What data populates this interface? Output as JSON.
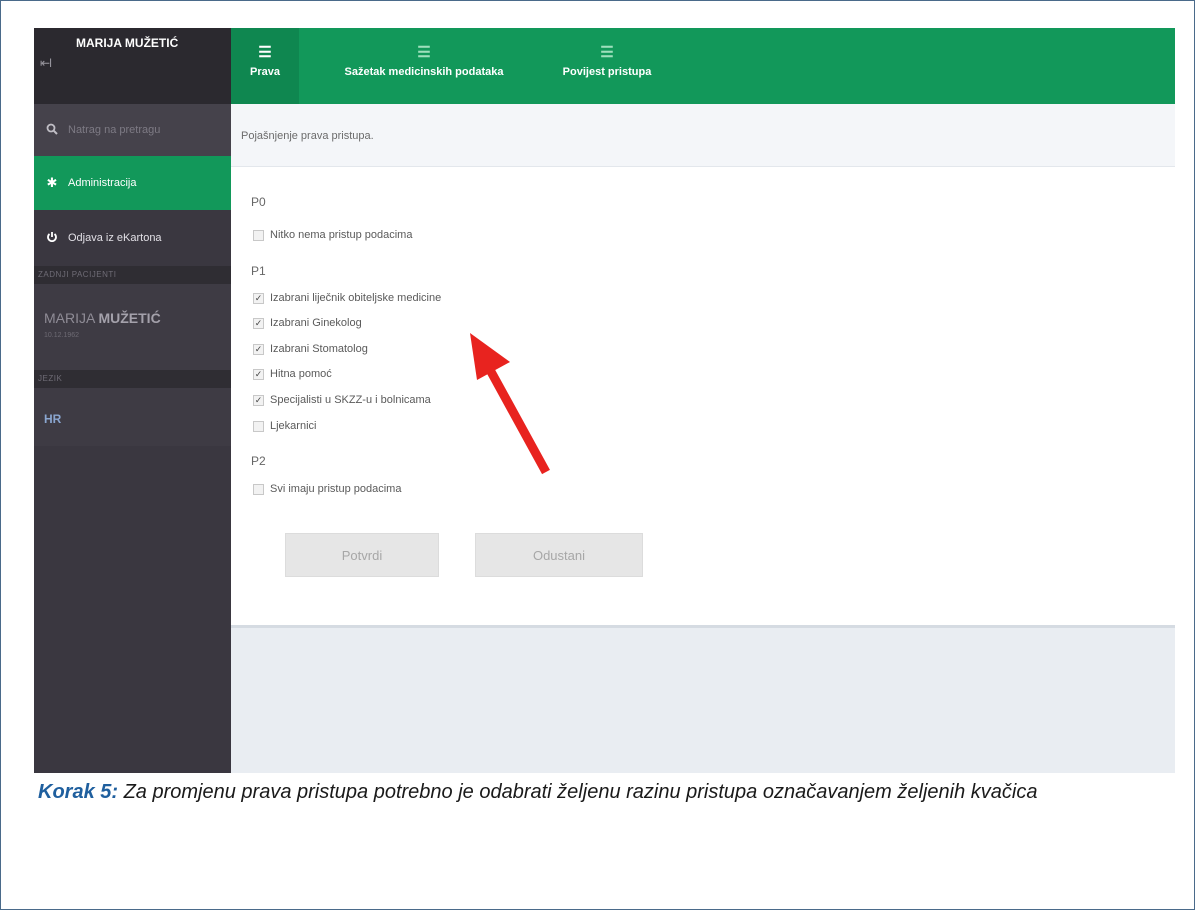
{
  "user": {
    "first_name": "MARIJA",
    "last_name": "MUŽETIĆ"
  },
  "sidebar": {
    "items": [
      {
        "label": "Natrag na pretragu",
        "icon": "search-icon"
      },
      {
        "label": "Administracija",
        "icon": "gear-icon"
      },
      {
        "label": "Odjava iz eKartona",
        "icon": "power-icon"
      }
    ],
    "recent_heading": "ZADNJI PACIJENTI",
    "recent_patient": {
      "first_name": "MARIJA",
      "last_name": "MUŽETIĆ",
      "date": "10.12.1962"
    },
    "language_heading": "JEZIK",
    "language": "HR"
  },
  "tabs": [
    {
      "label": "Prava",
      "icon": "list-icon",
      "active": true
    },
    {
      "label": "Sažetak medicinskih podataka",
      "icon": "list-icon",
      "active": false
    },
    {
      "label": "Povijest pristupa",
      "icon": "list-icon",
      "active": false
    }
  ],
  "info_text": "Pojašnjenje prava pristupa.",
  "levels": {
    "p0": {
      "label": "P0",
      "options": [
        {
          "label": "Nitko nema pristup podacima",
          "checked": false
        }
      ]
    },
    "p1": {
      "label": "P1",
      "options": [
        {
          "label": "Izabrani liječnik obiteljske medicine",
          "checked": true
        },
        {
          "label": "Izabrani Ginekolog",
          "checked": true
        },
        {
          "label": "Izabrani Stomatolog",
          "checked": true
        },
        {
          "label": "Hitna pomoć",
          "checked": true
        },
        {
          "label": "Specijalisti u SKZZ-u i bolnicama",
          "checked": true
        },
        {
          "label": "Ljekarnici",
          "checked": false
        }
      ]
    },
    "p2": {
      "label": "P2",
      "options": [
        {
          "label": "Svi imaju pristup podacima",
          "checked": false
        }
      ]
    }
  },
  "buttons": {
    "confirm": "Potvrdi",
    "cancel": "Odustani"
  },
  "caption": {
    "step": "Korak 5:",
    "text": " Za promjenu prava pristupa potrebno je odabrati željenu razinu pristupa označavanjem željenih kvačica"
  },
  "colors": {
    "green": "#12985a",
    "sidebar": "#3a3740",
    "arrow": "#e8231f",
    "step": "#1f5f9e"
  }
}
